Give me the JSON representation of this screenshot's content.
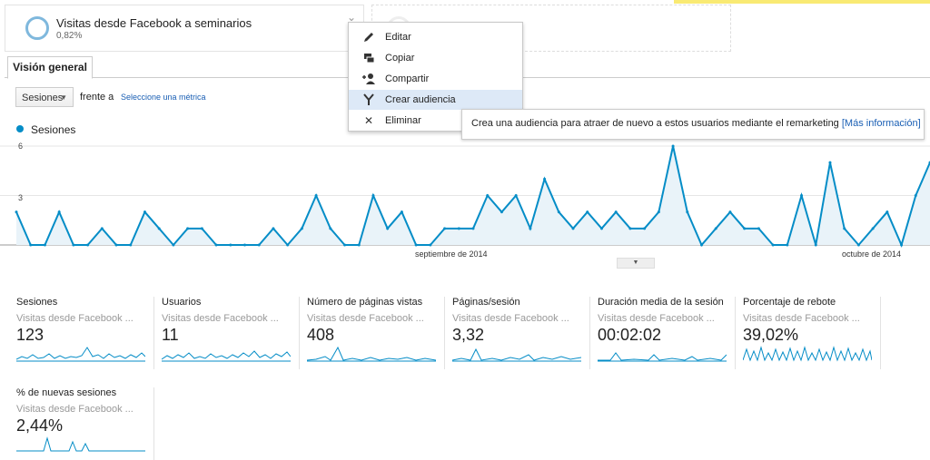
{
  "segment": {
    "title": "Visitas desde Facebook a seminarios",
    "percent": "0,82%"
  },
  "tab": {
    "label": "Visión general"
  },
  "controls": {
    "metric_selected": "Sesiones",
    "versus_label": "frente a",
    "select_metric_link": "Seleccione una métrica"
  },
  "legend": {
    "series_name": "Sesiones",
    "color": "#058dc7"
  },
  "context_menu": {
    "items": [
      {
        "label": "Editar",
        "icon": "pencil-icon"
      },
      {
        "label": "Copiar",
        "icon": "copy-icon"
      },
      {
        "label": "Compartir",
        "icon": "add-user-icon"
      },
      {
        "label": "Crear audiencia",
        "icon": "audience-icon",
        "highlighted": true
      },
      {
        "label": "Eliminar",
        "icon": "close-icon"
      }
    ]
  },
  "tooltip": {
    "text": "Crea una audiencia para atraer de nuevo a estos usuarios mediante el remarketing ",
    "link": "[Más información]"
  },
  "chart_data": {
    "type": "area",
    "series": [
      {
        "name": "Sesiones",
        "values": [
          2,
          0,
          0,
          2,
          0,
          0,
          1,
          0,
          0,
          2,
          1,
          0,
          1,
          1,
          0,
          0,
          0,
          0,
          1,
          0,
          1,
          3,
          1,
          0,
          0,
          3,
          1,
          2,
          0,
          0,
          1,
          1,
          1,
          3,
          2,
          3,
          1,
          4,
          2,
          1,
          2,
          1,
          2,
          1,
          1,
          2,
          6,
          2,
          0,
          1,
          2,
          1,
          1,
          0,
          0,
          3,
          0,
          5,
          1,
          0,
          1,
          2,
          0,
          3,
          5
        ]
      }
    ],
    "ylim": [
      0,
      6
    ],
    "yticks": [
      "6",
      "3"
    ],
    "xticks": [
      "septiembre de 2014",
      "octubre de 2014"
    ],
    "grid": true
  },
  "tiles": [
    {
      "name": "Sesiones",
      "segment": "Visitas desde Facebook ...",
      "value": "123"
    },
    {
      "name": "Usuarios",
      "segment": "Visitas desde Facebook ...",
      "value": "11"
    },
    {
      "name": "Número de páginas vistas",
      "segment": "Visitas desde Facebook ...",
      "value": "408"
    },
    {
      "name": "Páginas/sesión",
      "segment": "Visitas desde Facebook ...",
      "value": "3,32"
    },
    {
      "name": "Duración media de la sesión",
      "segment": "Visitas desde Facebook ...",
      "value": "00:02:02"
    },
    {
      "name": "Porcentaje de rebote",
      "segment": "Visitas desde Facebook ...",
      "value": "39,02%"
    },
    {
      "name": "% de nuevas sesiones",
      "segment": "Visitas desde Facebook ...",
      "value": "2,44%"
    }
  ]
}
